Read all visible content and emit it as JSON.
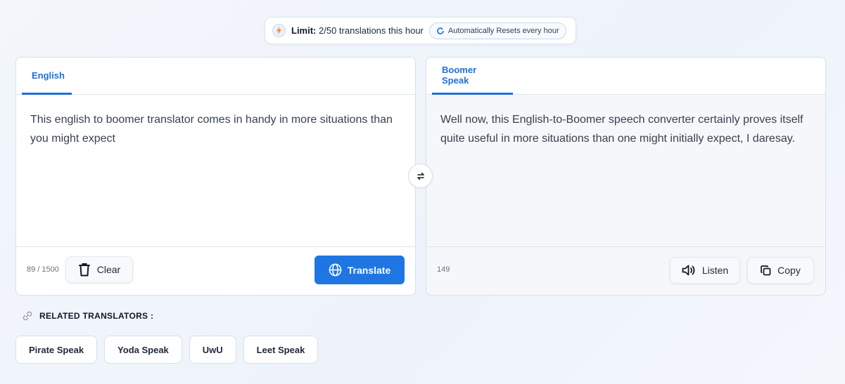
{
  "limit": {
    "label": "Limit:",
    "value": "2/50 translations this hour",
    "reset": "Automatically Resets every hour"
  },
  "source": {
    "tab": "English",
    "text": "This english to boomer translator comes in handy in more situations than you might expect",
    "count": "89 / 1500",
    "clear_label": "Clear",
    "translate_label": "Translate"
  },
  "target": {
    "tab": "Boomer Speak",
    "text": "Well now, this English-to-Boomer speech converter certainly proves itself quite useful in more situations than one might initially expect, I daresay.",
    "count": "149",
    "listen_label": "Listen",
    "copy_label": "Copy"
  },
  "related": {
    "heading": "RELATED TRANSLATORS :",
    "items": [
      "Pirate Speak",
      "Yoda Speak",
      "UwU",
      "Leet Speak"
    ]
  },
  "icons": {
    "bolt": "bolt-icon",
    "reset": "refresh-icon",
    "clear": "trash-icon",
    "translate": "globe-icon",
    "swap": "swap-icon",
    "listen": "speaker-icon",
    "copy": "copy-icon",
    "link": "link-icon"
  },
  "colors": {
    "accent": "#1f76e3",
    "tab_active": "#1f6fd8",
    "bolt": "#f08a2a"
  }
}
